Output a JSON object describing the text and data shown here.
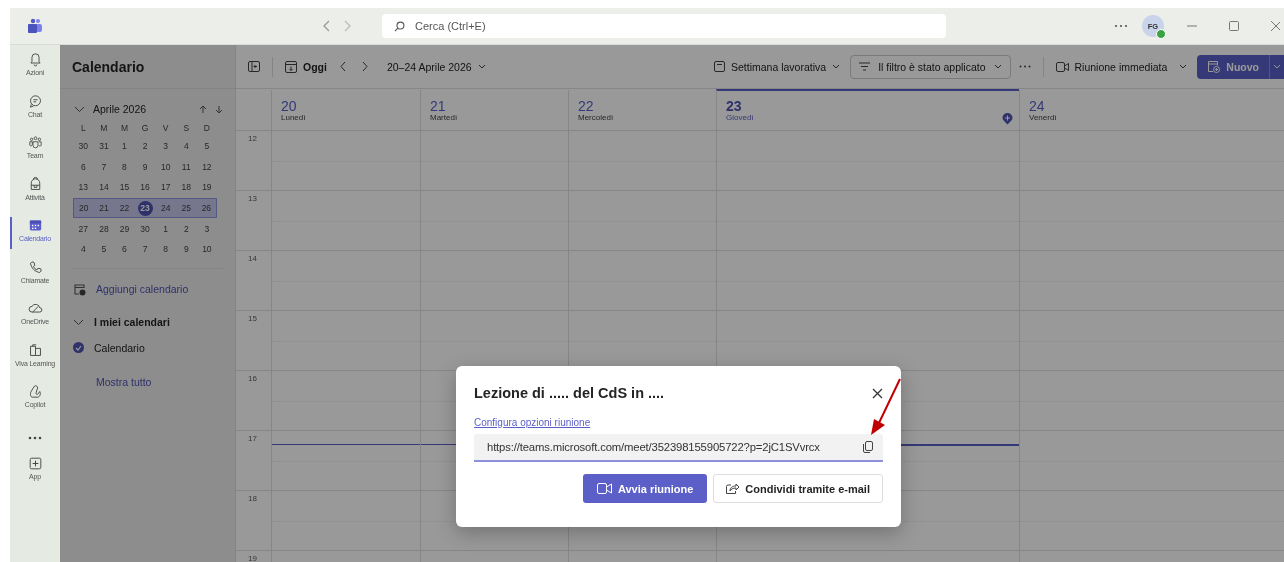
{
  "topbar": {
    "search_placeholder": "Cerca (Ctrl+E)",
    "avatar": "FG"
  },
  "rail": [
    {
      "label": "Azioni",
      "kind": "bell",
      "selected": false
    },
    {
      "label": "Chat",
      "kind": "chat",
      "selected": false
    },
    {
      "label": "Team",
      "kind": "team",
      "selected": false
    },
    {
      "label": "Attività",
      "kind": "bag",
      "selected": false
    },
    {
      "label": "Calendario",
      "kind": "calendar",
      "selected": true
    },
    {
      "label": "Chiamate",
      "kind": "phone",
      "selected": false
    },
    {
      "label": "OneDrive",
      "kind": "cloud",
      "selected": false
    },
    {
      "label": "Viva Learning",
      "kind": "book",
      "selected": false
    },
    {
      "label": "Copilot",
      "kind": "copilot",
      "selected": false
    },
    {
      "kind": "more",
      "selected": false
    },
    {
      "label": "App",
      "kind": "plus",
      "selected": false
    }
  ],
  "sidebar": {
    "title": "Calendario",
    "month": "Aprile 2026",
    "month_expanded": true,
    "weekdays": [
      "L",
      "M",
      "M",
      "G",
      "V",
      "S",
      "D"
    ],
    "weeks": [
      {
        "selected": false,
        "days": [
          {
            "label": "30",
            "today": false
          },
          {
            "label": "31",
            "today": false
          },
          {
            "label": "1",
            "today": false
          },
          {
            "label": "2",
            "today": false
          },
          {
            "label": "3",
            "today": false
          },
          {
            "label": "4",
            "today": false
          },
          {
            "label": "5",
            "today": false
          }
        ]
      },
      {
        "selected": false,
        "days": [
          {
            "label": "6",
            "today": false
          },
          {
            "label": "7",
            "today": false
          },
          {
            "label": "8",
            "today": false
          },
          {
            "label": "9",
            "today": false
          },
          {
            "label": "10",
            "today": false
          },
          {
            "label": "11",
            "today": false
          },
          {
            "label": "12",
            "today": false
          }
        ]
      },
      {
        "selected": false,
        "days": [
          {
            "label": "13",
            "today": false
          },
          {
            "label": "14",
            "today": false
          },
          {
            "label": "15",
            "today": false
          },
          {
            "label": "16",
            "today": false
          },
          {
            "label": "17",
            "today": false
          },
          {
            "label": "18",
            "today": false
          },
          {
            "label": "19",
            "today": false
          }
        ]
      },
      {
        "selected": true,
        "days": [
          {
            "label": "20",
            "today": false
          },
          {
            "label": "21",
            "today": false
          },
          {
            "label": "22",
            "today": false
          },
          {
            "label": "23",
            "today": true
          },
          {
            "label": "24",
            "today": false
          },
          {
            "label": "25",
            "today": false
          },
          {
            "label": "26",
            "today": false
          }
        ]
      },
      {
        "selected": false,
        "days": [
          {
            "label": "27",
            "today": false
          },
          {
            "label": "28",
            "today": false
          },
          {
            "label": "29",
            "today": false
          },
          {
            "label": "30",
            "today": false
          },
          {
            "label": "1",
            "today": false
          },
          {
            "label": "2",
            "today": false
          },
          {
            "label": "3",
            "today": false
          }
        ]
      },
      {
        "selected": false,
        "days": [
          {
            "label": "4",
            "today": false
          },
          {
            "label": "5",
            "today": false
          },
          {
            "label": "6",
            "today": false
          },
          {
            "label": "7",
            "today": false
          },
          {
            "label": "8",
            "today": false
          },
          {
            "label": "9",
            "today": false
          },
          {
            "label": "10",
            "today": false
          }
        ]
      }
    ],
    "add_calendar": "Aggiungi calendario",
    "my_calendars": {
      "title": "I miei calendari",
      "expanded": true,
      "items": [
        {
          "label": "Calendario",
          "checked": true
        }
      ]
    },
    "show_all": "Mostra tutto"
  },
  "toolbar": {
    "today": "Oggi",
    "range": "20–24 Aprile 2026",
    "view": "Settimana lavorativa",
    "filter": "Il filtro è stato applicato",
    "meet_now": "Riunione immediata",
    "new": "Nuovo"
  },
  "days": [
    {
      "number": "20",
      "name": "Lunedì",
      "selected": false
    },
    {
      "number": "21",
      "name": "Martedì",
      "selected": false
    },
    {
      "number": "22",
      "name": "Mercoledì",
      "selected": false
    },
    {
      "number": "23",
      "name": "Giovedì",
      "selected": true
    },
    {
      "number": "24",
      "name": "Venerdì",
      "selected": false
    }
  ],
  "hours": [
    {
      "label": "12",
      "current": false
    },
    {
      "label": "13",
      "current": false
    },
    {
      "label": "14",
      "current": false
    },
    {
      "label": "15",
      "current": false
    },
    {
      "label": "16",
      "current": false
    },
    {
      "label": "17",
      "current": true
    },
    {
      "label": "18",
      "current": false
    },
    {
      "label": "19",
      "current": false
    }
  ],
  "dialog": {
    "title": "Lezione di ..... del CdS in ....",
    "link": "Configura opzioni riunione",
    "url": "https://teams.microsoft.com/meet/352398155905722?p=2jC1SVvrcx",
    "primary": "Avvia riunione",
    "secondary": "Condividi tramite e-mail"
  }
}
